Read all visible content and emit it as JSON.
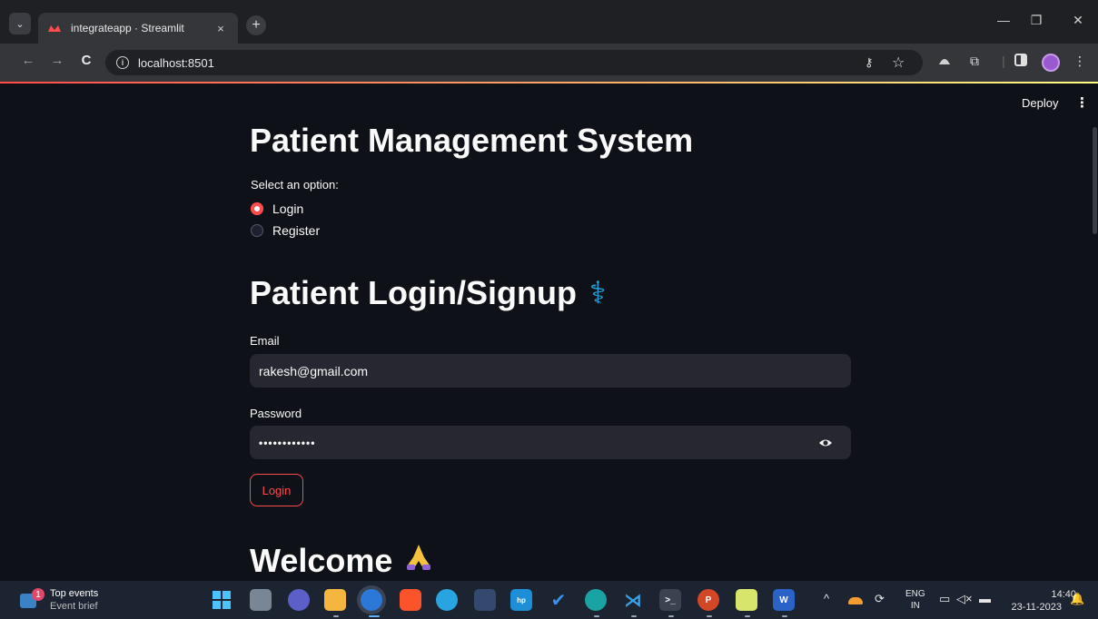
{
  "browser": {
    "tab_title": "integrateapp · Streamlit",
    "url": "localhost:8501",
    "tab_close": "×",
    "new_tab": "+",
    "tab_menu": "⌄",
    "win_min": "—",
    "win_restore": "❐",
    "win_close": "✕",
    "back": "←",
    "forward": "→",
    "reload": "C",
    "key_icon": "⚷",
    "star_icon": "☆",
    "extensions_icon": "⧉",
    "menu_icon": "⋮"
  },
  "app": {
    "deploy_label": "Deploy",
    "menu_glyph": "⋮",
    "title": "Patient Management System",
    "select_label": "Select an option:",
    "options": [
      {
        "label": "Login",
        "selected": true
      },
      {
        "label": "Register",
        "selected": false
      }
    ],
    "login_heading": "Patient Login/Signup",
    "login_heading_icon": "⚕",
    "email_label": "Email",
    "email_value": "rakesh@gmail.com",
    "password_label": "Password",
    "password_value": "••••••••••••",
    "login_button": "Login",
    "welcome_heading": "Welcome",
    "welcome_icon": "🙏"
  },
  "colors": {
    "accent": "#ff4b4b",
    "background": "#0e1117",
    "input_bg": "#262730",
    "icon_blue": "#1ea7e1"
  },
  "taskbar": {
    "widget_title": "Top events",
    "widget_subtitle": "Event brief",
    "widget_badge": "1",
    "lang_top": "ENG",
    "lang_bottom": "IN",
    "time": "14:40",
    "date": "23-11-2023"
  }
}
